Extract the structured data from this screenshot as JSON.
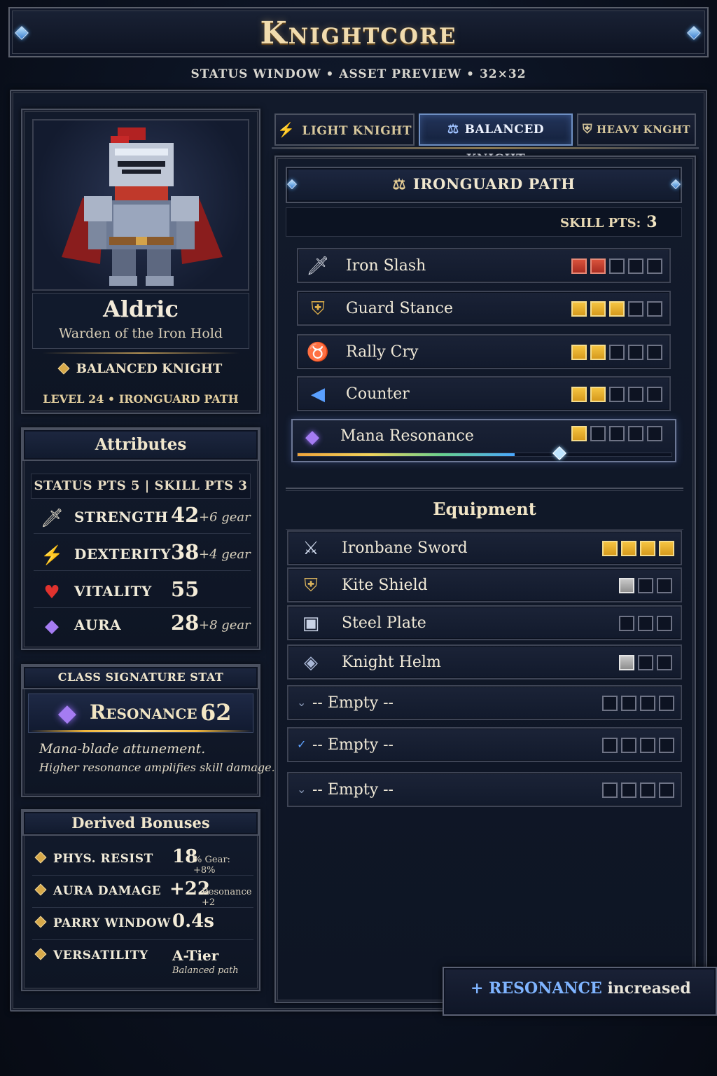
{
  "header": {
    "title": "Knightcore",
    "subtitle": "STATUS WINDOW • ASSET PREVIEW • 32×32"
  },
  "hero": {
    "name": "Aldric",
    "description": "Warden of the Iron Hold",
    "class_label": "BALANCED KNIGHT",
    "level_line": "LEVEL 24 • IRONGUARD PATH"
  },
  "attributes": {
    "title": "Attributes",
    "points_line": "STATUS PTS  5  |  SKILL PTS  3",
    "rows": [
      {
        "icon": "sword-icon",
        "name": "STRENGTH",
        "value": "42",
        "gear": "+6 gear"
      },
      {
        "icon": "boot-icon",
        "name": "DEXTERITY",
        "value": "38",
        "gear": "+4 gear"
      },
      {
        "icon": "heart-icon",
        "name": "VITALITY",
        "value": "55",
        "gear": ""
      },
      {
        "icon": "crystal-icon",
        "name": "AURA",
        "value": "28",
        "gear": "+8 gear"
      }
    ]
  },
  "signature": {
    "title": "CLASS SIGNATURE STAT",
    "stat_name": "Resonance",
    "stat_value": "62",
    "line1": "Mana-blade attunement.",
    "line2": "Higher resonance amplifies skill damage."
  },
  "derived": {
    "title": "Derived Bonuses",
    "rows": [
      {
        "label": "PHYS. RESIST",
        "value": "18",
        "suffix": "% Gear: +8%"
      },
      {
        "label": "AURA DAMAGE",
        "value": "+22",
        "suffix": "Resonance +2"
      },
      {
        "label": "PARRY WINDOW",
        "value": "0.4s",
        "suffix": ""
      },
      {
        "label": "VERSATILITY",
        "value": "A-Tier",
        "suffix": "Balanced path"
      }
    ]
  },
  "tabs": [
    {
      "label": "LIGHT KNIGHT",
      "icon": "lightning-icon",
      "active": false
    },
    {
      "label": "BALANCED KNIGHT",
      "icon": "scales-icon",
      "active": true
    },
    {
      "label": "HEAVY KNGHT",
      "icon": "shield-icon",
      "active": false
    }
  ],
  "path": {
    "title": "IRONGUARD PATH",
    "skill_pts_label": "SKILL PTS:",
    "skill_pts_value": "3",
    "skills": [
      {
        "name": "Iron Slash",
        "icon": "sword-icon",
        "filled": 2,
        "total": 5,
        "color": "red"
      },
      {
        "name": "Guard Stance",
        "icon": "shield-icon",
        "filled": 3,
        "total": 5,
        "color": "gold"
      },
      {
        "name": "Rally Cry",
        "icon": "horn-icon",
        "filled": 2,
        "total": 5,
        "color": "gold"
      },
      {
        "name": "Counter",
        "icon": "counter-icon",
        "filled": 2,
        "total": 5,
        "color": "gold"
      },
      {
        "name": "Mana Resonance",
        "icon": "crystal-icon",
        "filled": 1,
        "total": 5,
        "color": "gold",
        "progress": 0.58
      }
    ]
  },
  "equipment": {
    "title": "Equipment",
    "items": [
      {
        "name": "Ironbane Sword",
        "icon": "sword-icon",
        "filled": 4,
        "total": 4,
        "color": "gold"
      },
      {
        "name": "Kite Shield",
        "icon": "shield-icon",
        "filled": 1,
        "total": 3,
        "color": "grey"
      },
      {
        "name": "Steel Plate",
        "icon": "armor-icon",
        "filled": 0,
        "total": 3,
        "color": "grey"
      },
      {
        "name": "Knight Helm",
        "icon": "helm-icon",
        "filled": 1,
        "total": 3,
        "color": "grey"
      },
      {
        "name": "-- Empty --",
        "icon": "chevron-icon",
        "filled": 0,
        "total": 4,
        "color": "grey"
      },
      {
        "name": "-- Empty --",
        "icon": "chevron-icon",
        "filled": 0,
        "total": 4,
        "color": "grey"
      },
      {
        "name": "-- Empty --",
        "icon": "chevron-icon",
        "filled": 0,
        "total": 4,
        "color": "grey"
      }
    ]
  },
  "toast": {
    "plus": "+",
    "highlight": "RESONANCE",
    "text": "increased"
  },
  "colors": {
    "accent_gold": "#e8cf95",
    "accent_blue": "#7fb4ff",
    "pip_gold": "#f5c441",
    "pip_red": "#d9523c"
  }
}
